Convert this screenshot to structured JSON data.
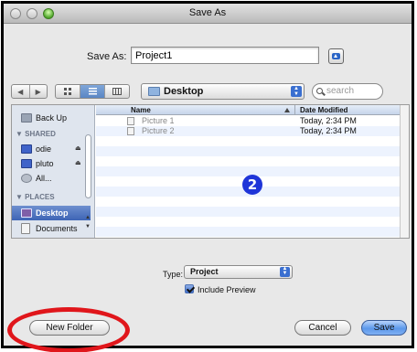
{
  "window": {
    "title": "Save As"
  },
  "save_as": {
    "label": "Save As:",
    "value": "Project1"
  },
  "toolbar": {
    "back_glyph": "◀",
    "forward_glyph": "▶",
    "location": "Desktop",
    "search_placeholder": "search"
  },
  "sidebar": {
    "items_top": [
      {
        "label": "Back Up"
      }
    ],
    "shared_header": "▼ SHARED",
    "shared": [
      {
        "label": "odie"
      },
      {
        "label": "pluto"
      },
      {
        "label": "All..."
      }
    ],
    "places_header": "▼ PLACES",
    "places": [
      {
        "label": "Desktop",
        "selected": true
      },
      {
        "label": "Documents"
      }
    ]
  },
  "file_list": {
    "columns": {
      "name": "Name",
      "date": "Date Modified"
    },
    "rows": [
      {
        "name": "Picture 1",
        "date": "Today, 2:34 PM"
      },
      {
        "name": "Picture 2",
        "date": "Today, 2:34 PM"
      }
    ]
  },
  "annotation": {
    "marker": "2"
  },
  "options": {
    "type_label": "Type:",
    "type_value": "Project",
    "include_preview_label": "Include Preview",
    "include_preview_checked": true
  },
  "buttons": {
    "new_folder": "New Folder",
    "cancel": "Cancel",
    "save": "Save"
  },
  "colors": {
    "accent": "#3a6fd0",
    "highlight_ring": "#e0161b",
    "annotation_marker": "#1f35d8"
  }
}
